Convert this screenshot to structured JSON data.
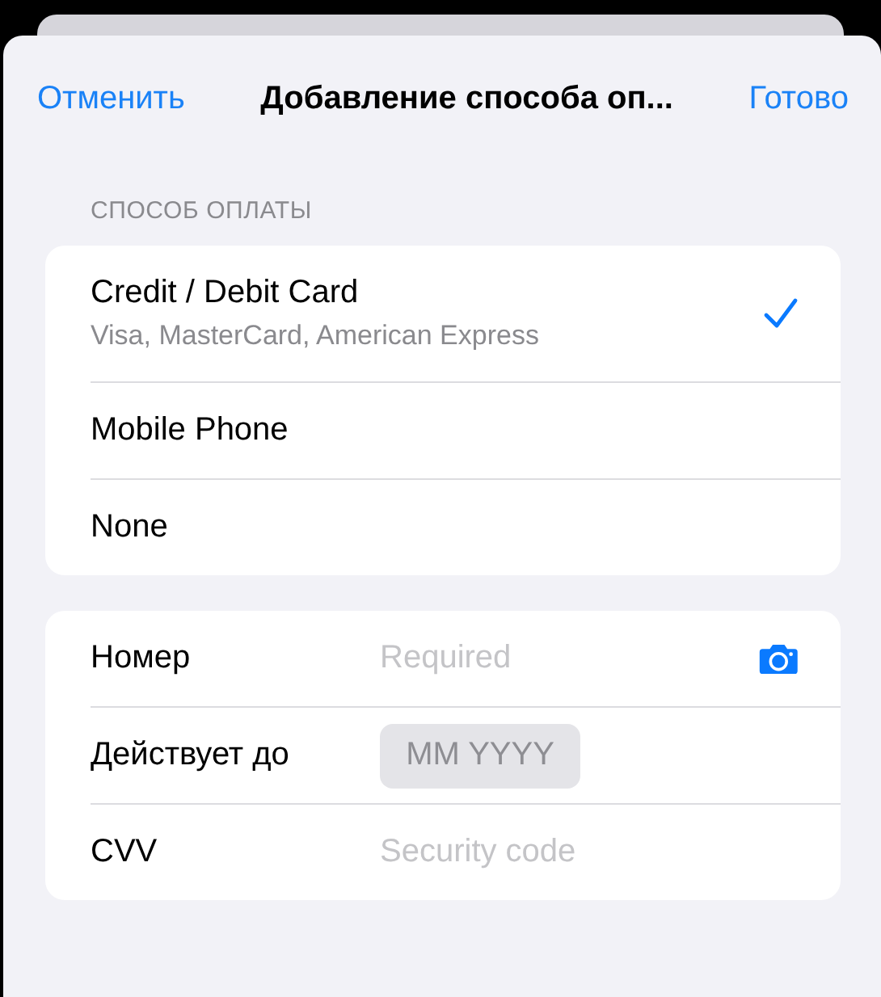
{
  "nav": {
    "cancel": "Отменить",
    "title": "Добавление способа оп...",
    "done": "Готово"
  },
  "payment_method": {
    "header": "СПОСОБ ОПЛАТЫ",
    "options": [
      {
        "label": "Credit / Debit Card",
        "subtitle": "Visa, MasterCard, American Express",
        "selected": true
      },
      {
        "label": "Mobile Phone",
        "selected": false
      },
      {
        "label": "None",
        "selected": false
      }
    ]
  },
  "card_fields": [
    {
      "kind": "scan",
      "label": "Номер",
      "placeholder": "Required"
    },
    {
      "kind": "date",
      "label": "Действует до",
      "placeholder": "MM YYYY"
    },
    {
      "kind": "text",
      "label": "CVV",
      "placeholder": "Security code"
    }
  ]
}
